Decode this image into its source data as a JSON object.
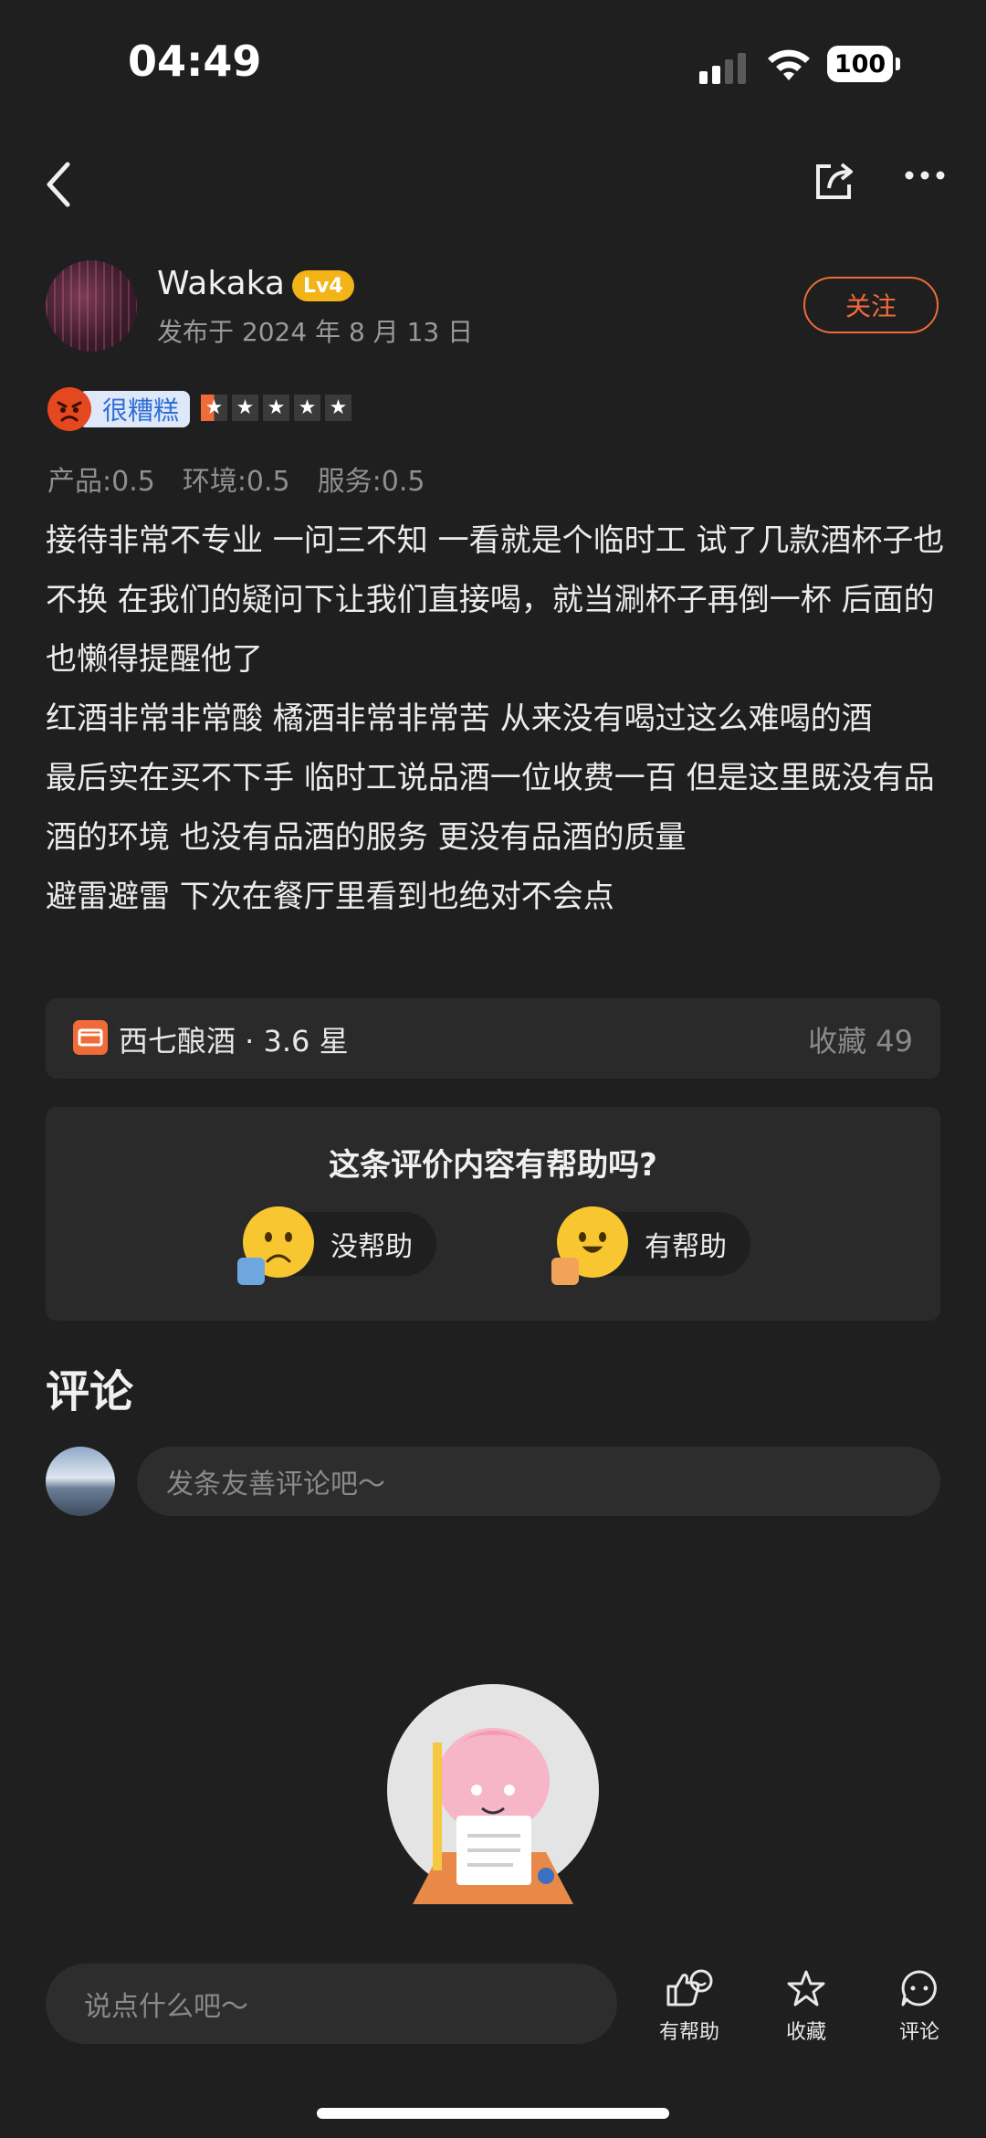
{
  "status_bar": {
    "time": "04:49",
    "battery": "100"
  },
  "user": {
    "name": "Wakaka",
    "level": "Lv4",
    "published": "发布于 2024 年 8 月 13 日",
    "follow_label": "关注"
  },
  "rating": {
    "label": "很糟糕",
    "stars": 0.5,
    "subscores": [
      "产品:0.5",
      "环境:0.5",
      "服务:0.5"
    ]
  },
  "review": {
    "lines": [
      "接待非常不专业 一问三不知 一看就是个临时工 试了几款酒杯子也不换 在我们的疑问下让我们直接喝，就当涮杯子再倒一杯 后面的也懒得提醒他了",
      "红酒非常非常酸 橘酒非常非常苦 从来没有喝过这么难喝的酒",
      "最后实在买不下手 临时工说品酒一位收费一百 但是这里既没有品酒的环境 也没有品酒的服务 更没有品酒的质量",
      "避雷避雷 下次在餐厅里看到也绝对不会点"
    ]
  },
  "shop": {
    "name": "西七酿酒 · 3.6 星",
    "fav": "收藏 49"
  },
  "helpful": {
    "question": "这条评价内容有帮助吗?",
    "no_label": "没帮助",
    "yes_label": "有帮助"
  },
  "comments": {
    "title": "评论",
    "placeholder": "发条友善评论吧～"
  },
  "bottom": {
    "input_placeholder": "说点什么吧～",
    "helpful": "有帮助",
    "favorite": "收藏",
    "comment": "评论"
  },
  "colors": {
    "accent": "#f06b3a",
    "background": "#1f1f1f",
    "level_badge": "#f2b417"
  }
}
